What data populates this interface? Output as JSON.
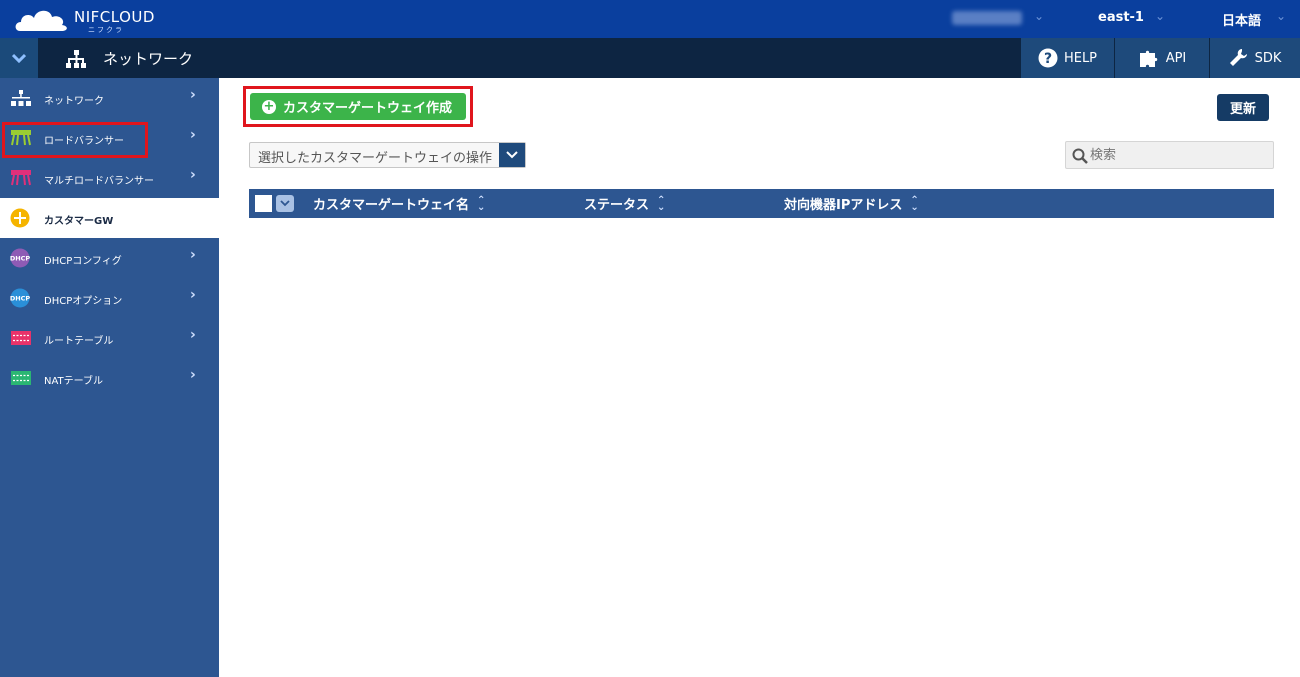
{
  "brand": {
    "name": "NIFCLOUD",
    "sub": "ニフクラ"
  },
  "top": {
    "region": "east-1",
    "language": "日本語"
  },
  "header": {
    "section_title": "ネットワーク"
  },
  "tools": [
    {
      "label": "HELP",
      "icon": "help-icon"
    },
    {
      "label": "API",
      "icon": "puzzle-icon"
    },
    {
      "label": "SDK",
      "icon": "wrench-icon"
    }
  ],
  "sidebar": {
    "items": [
      {
        "label": "ネットワーク",
        "icon": "network-icon",
        "active": false
      },
      {
        "label": "ロードバランサー",
        "icon": "load-balancer-icon",
        "active": false
      },
      {
        "label": "マルチロードバランサー",
        "icon": "multi-load-balancer-icon",
        "active": false
      },
      {
        "label": "カスタマーGW",
        "icon": "customer-gateway-icon",
        "active": true
      },
      {
        "label": "DHCPコンフィグ",
        "icon": "dhcp-config-icon",
        "active": false
      },
      {
        "label": "DHCPオプション",
        "icon": "dhcp-option-icon",
        "active": false
      },
      {
        "label": "ルートテーブル",
        "icon": "route-table-icon",
        "active": false
      },
      {
        "label": "NATテーブル",
        "icon": "nat-table-icon",
        "active": false
      }
    ]
  },
  "main": {
    "create_label": "カスタマーゲートウェイ作成",
    "refresh_label": "更新",
    "operation_placeholder": "選択したカスタマーゲートウェイの操作",
    "search_placeholder": "検索",
    "columns": [
      "カスタマーゲートウェイ名",
      "ステータス",
      "対向機器IPアドレス"
    ]
  },
  "colors": {
    "top_bar": "#0a3f9e",
    "sub_bar": "#0d2542",
    "sidebar": "#2d5691",
    "create_button": "#3cb44a",
    "highlight_outline": "#e0151d"
  }
}
